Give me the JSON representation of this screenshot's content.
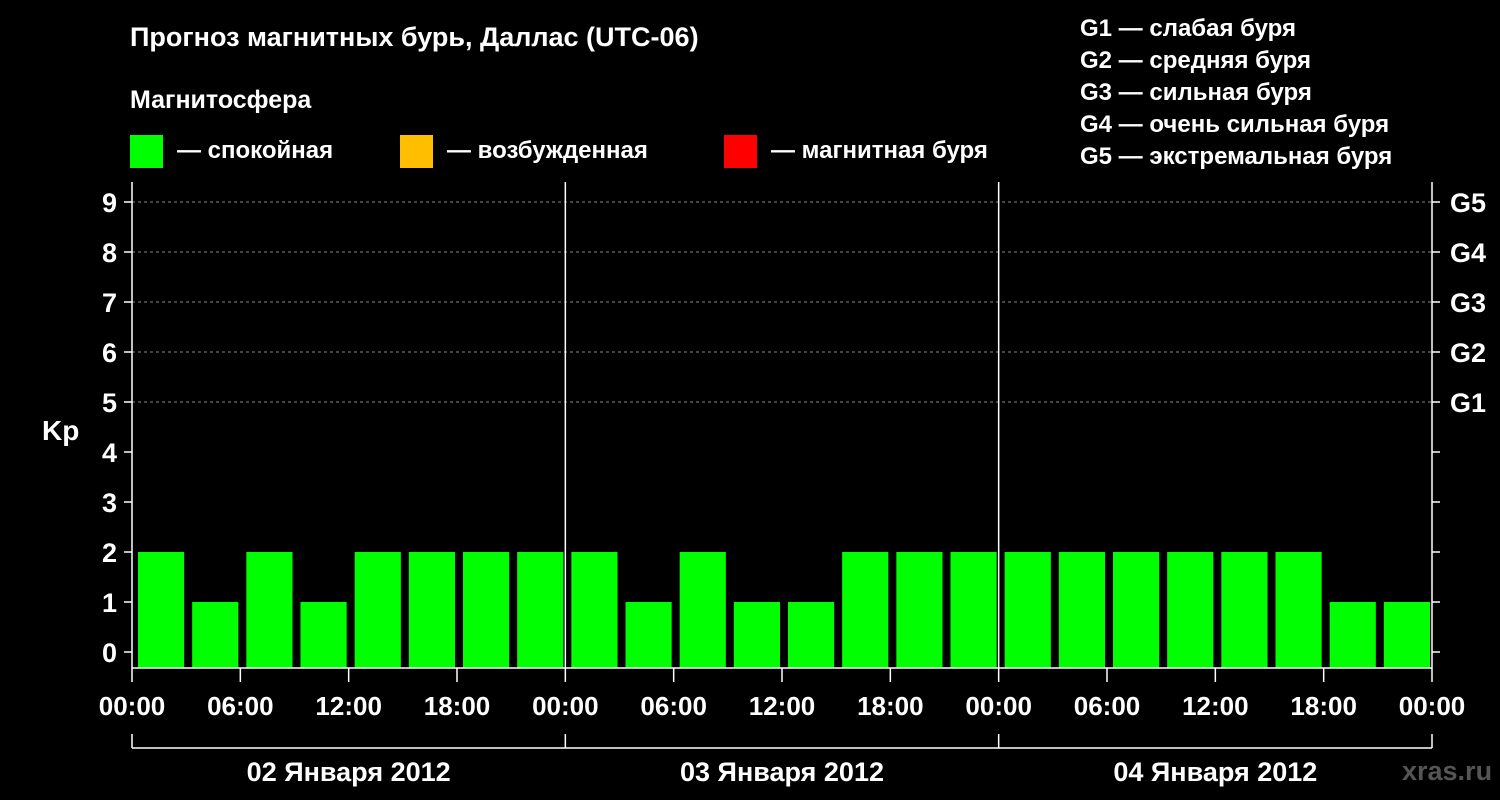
{
  "title": "Прогноз магнитных бурь, Даллас (UTC-06)",
  "legend": {
    "heading": "Магнитосфера",
    "items": [
      {
        "label": "— спокойная",
        "color": "#00ff00"
      },
      {
        "label": "— возбужденная",
        "color": "#ffbf00"
      },
      {
        "label": "— магнитная буря",
        "color": "#ff0000"
      }
    ]
  },
  "g_scale": [
    "G1 — слабая буря",
    "G2 — средняя буря",
    "G3 — сильная буря",
    "G4 — очень сильная буря",
    "G5 — экстремальная буря"
  ],
  "watermark": "xras.ru",
  "chart_data": {
    "type": "bar",
    "ylabel": "Kp",
    "ylim": [
      0,
      9
    ],
    "yticks": [
      0,
      1,
      2,
      3,
      4,
      5,
      6,
      7,
      8,
      9
    ],
    "right_axis_labels": [
      {
        "kp": 5,
        "label": "G1"
      },
      {
        "kp": 6,
        "label": "G2"
      },
      {
        "kp": 7,
        "label": "G3"
      },
      {
        "kp": 8,
        "label": "G4"
      },
      {
        "kp": 9,
        "label": "G5"
      }
    ],
    "x_tick_labels": [
      "00:00",
      "06:00",
      "12:00",
      "18:00",
      "00:00",
      "06:00",
      "12:00",
      "18:00",
      "00:00",
      "06:00",
      "12:00",
      "18:00",
      "00:00"
    ],
    "days": [
      "02 Января 2012",
      "03 Января 2012",
      "04 Января 2012"
    ],
    "bar_color": "#00ff00",
    "values": [
      2,
      1,
      2,
      1,
      2,
      2,
      2,
      2,
      2,
      1,
      2,
      1,
      1,
      2,
      2,
      2,
      2,
      2,
      2,
      2,
      2,
      2,
      1,
      1
    ],
    "grid": "dashed at Kp 5–9"
  }
}
